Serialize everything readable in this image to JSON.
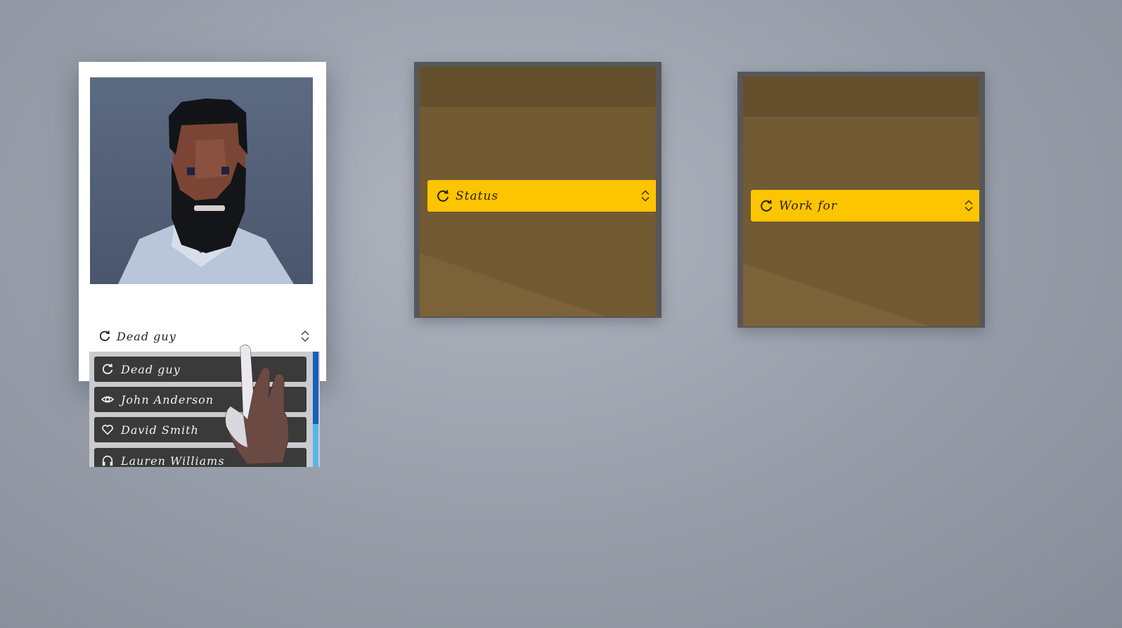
{
  "character_card": {
    "portrait_alt": "bearded man avatar",
    "selected_value": "Dead guy",
    "selected_icon": "refresh-icon"
  },
  "dropdown": {
    "items": [
      {
        "label": "Dead guy",
        "icon": "refresh-icon"
      },
      {
        "label": "John Anderson",
        "icon": "eye-icon"
      },
      {
        "label": "David Smith",
        "icon": "heart-icon"
      },
      {
        "label": "Lauren Williams",
        "icon": "headphones-icon"
      }
    ],
    "scroll_fraction": 0.63
  },
  "status_box": {
    "select_label": "Status",
    "select_icon": "refresh-icon"
  },
  "workfor_box": {
    "select_label": "Work for",
    "select_icon": "refresh-icon"
  },
  "colors": {
    "accent_yellow": "#fdc400",
    "box_brown": "#725a33",
    "list_item_dark": "#3a3a3a",
    "scrollbar_blue": "#1560b8"
  }
}
